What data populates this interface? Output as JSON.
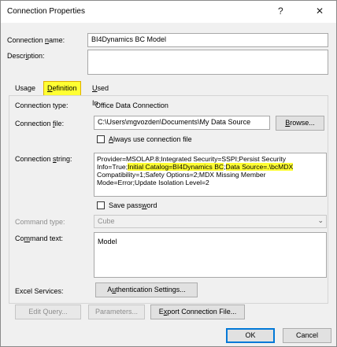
{
  "window": {
    "title": "Connection Properties",
    "help_label": "?",
    "close_label": "✕"
  },
  "header": {
    "name_label": "Connection name:",
    "name_value": "BI4Dynamics BC Model",
    "description_label": "Description:",
    "description_value": ""
  },
  "tabs": [
    {
      "label": "Usage",
      "active": false
    },
    {
      "label": "Definition",
      "active": true
    },
    {
      "label": "Used In",
      "active": false
    }
  ],
  "definition": {
    "type_label": "Connection type:",
    "type_value": "Office Data Connection",
    "file_label": "Connection file:",
    "file_value": "C:\\Users\\mgvozden\\Documents\\My Data Source",
    "browse_label": "Browse...",
    "always_use_label": "Always use connection file",
    "string_label": "Connection string:",
    "string_parts": [
      "Provider=MSOLAP.8;Integrated Security=SSPI;Persist Security Info=True;",
      "Initial Catalog=BI4Dynamics BC",
      ";",
      "Data Source=.\\bcMDX",
      " Compatibility=1;Safety Options=2;MDX Missing Member Mode=Error;Update Isolation Level=2"
    ],
    "save_password_label": "Save password",
    "command_type_label": "Command type:",
    "command_type_value": "Cube",
    "command_text_label": "Command text:",
    "command_text_value": "Model",
    "excel_services_label": "Excel Services:",
    "auth_settings_label": "Authentication Settings..."
  },
  "bottom": {
    "edit_query_label": "Edit Query...",
    "parameters_label": "Parameters...",
    "export_label": "Export Connection File...",
    "ok_label": "OK",
    "cancel_label": "Cancel"
  },
  "colors": {
    "highlight": "#ffff33",
    "accent": "#0078d7"
  }
}
